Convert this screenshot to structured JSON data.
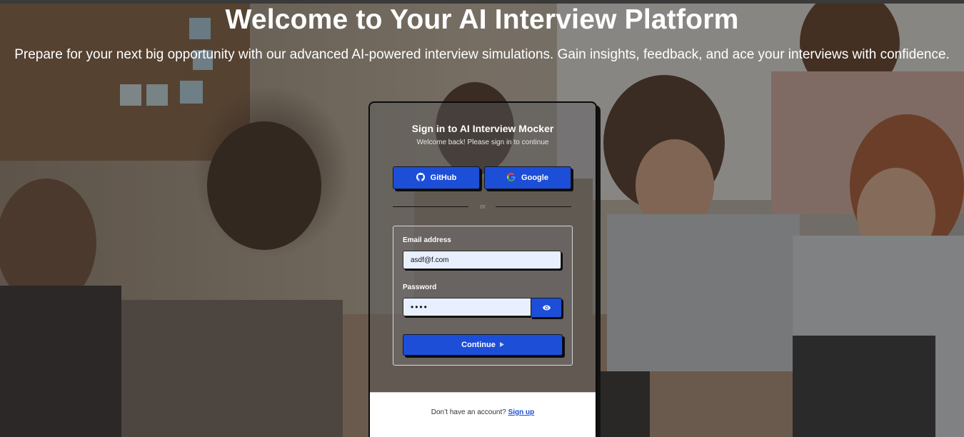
{
  "hero": {
    "title": "Welcome to Your AI Interview Platform",
    "subtitle": "Prepare for your next big opportunity with our advanced AI-powered interview simulations. Gain insights, feedback, and ace your interviews with confidence."
  },
  "signin": {
    "title": "Sign in to AI Interview Mocker",
    "subtitle": "Welcome back! Please sign in to continue",
    "github_label": "GitHub",
    "google_label": "Google",
    "divider": "or",
    "email_label": "Email address",
    "email_value": "asdf@f.com",
    "password_label": "Password",
    "password_value": "••••",
    "continue_label": "Continue",
    "footer_prefix": "Don’t have an account?",
    "signup_label": "Sign up"
  },
  "colors": {
    "accent": "#1d4ed8",
    "input_bg": "#e8efff"
  }
}
